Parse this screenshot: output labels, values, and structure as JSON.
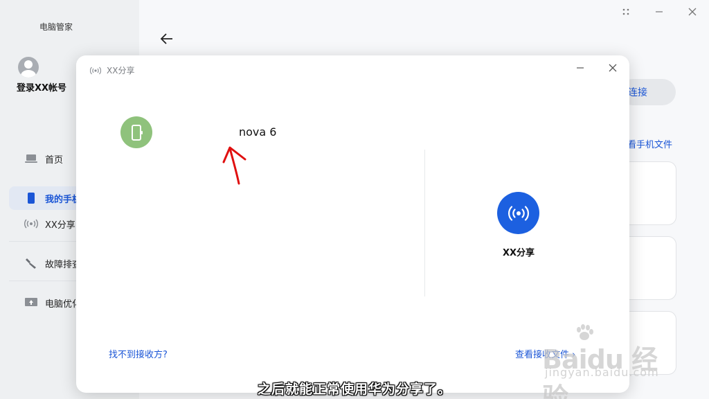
{
  "app": {
    "title": "电脑管家",
    "login_label": "登录XX帐号",
    "nav": [
      {
        "label": "首页",
        "icon": "laptop-icon"
      },
      {
        "label": "我的手机",
        "icon": "phone-icon",
        "active": true
      },
      {
        "label": "XX分享",
        "icon": "share-signal-icon"
      },
      {
        "label": "故障排查",
        "icon": "wrench-icon"
      },
      {
        "label": "电脑优化",
        "icon": "optimize-icon"
      }
    ],
    "connect_label": "连接",
    "view_files_label": "看手机文件"
  },
  "dialog": {
    "title": "XX分享",
    "device_name": "nova 6",
    "share_label": "XX分享",
    "link_left": "找不到接收方?",
    "link_right": "查看接收文件 ›"
  },
  "watermark": {
    "main": "Baidu 经验",
    "sub": "jingyan.baidu.com"
  },
  "subtitle": "之后就能正常使用华为分享了。",
  "colors": {
    "accent": "#1c60e0",
    "phone_green": "#8fc27c",
    "annotation_red": "#e01010"
  }
}
